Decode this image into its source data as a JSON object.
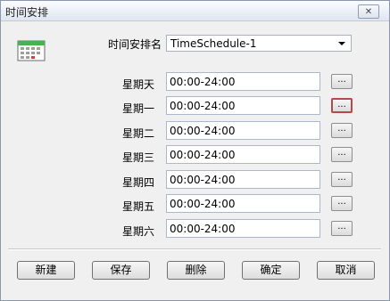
{
  "window": {
    "title": "时间安排",
    "close_glyph": "✕"
  },
  "schedule": {
    "label": "时间安排名",
    "selected": "TimeSchedule-1"
  },
  "days": [
    {
      "label": "星期天",
      "value": "00:00-24:00",
      "button": "..."
    },
    {
      "label": "星期一",
      "value": "00:00-24:00",
      "button": "..."
    },
    {
      "label": "星期二",
      "value": "00:00-24:00",
      "button": "..."
    },
    {
      "label": "星期三",
      "value": "00:00-24:00",
      "button": "..."
    },
    {
      "label": "星期四",
      "value": "00:00-24:00",
      "button": "..."
    },
    {
      "label": "星期五",
      "value": "00:00-24:00",
      "button": "..."
    },
    {
      "label": "星期六",
      "value": "00:00-24:00",
      "button": "..."
    }
  ],
  "buttons": {
    "new": "新建",
    "save": "保存",
    "delete": "删除",
    "ok": "确定",
    "cancel": "取消"
  },
  "icons": {
    "app": "calendar-grid-icon",
    "close": "close-icon",
    "dropdown": "chevron-down-icon"
  },
  "colors": {
    "focus_border": "#b44a4a",
    "accent_green": "#4caf50"
  }
}
